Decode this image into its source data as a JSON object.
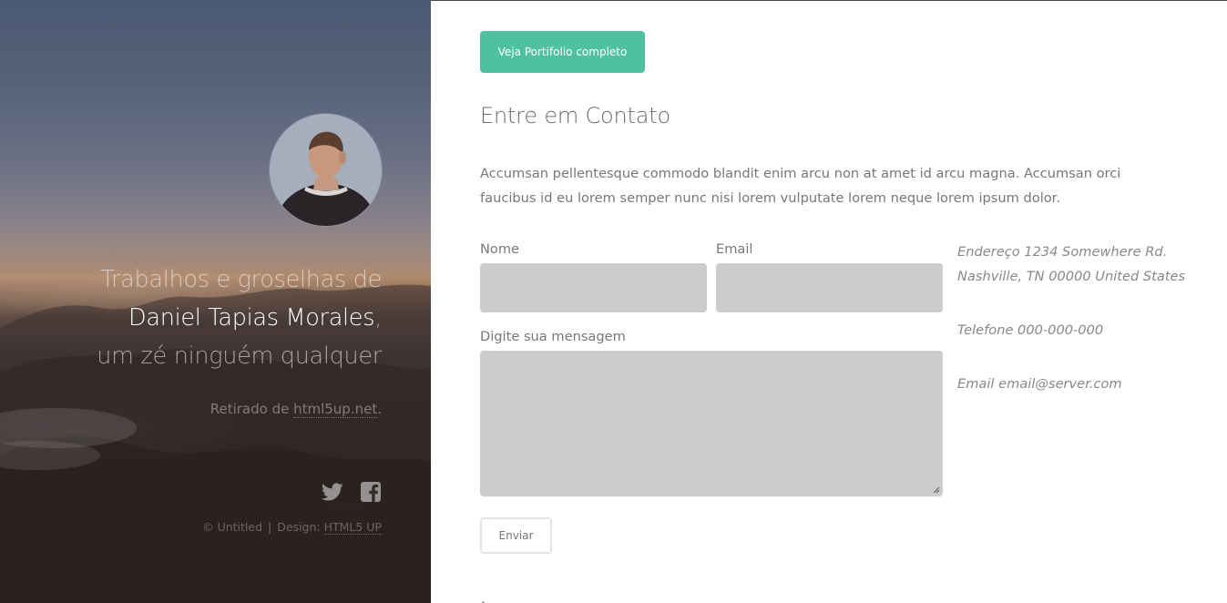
{
  "sidebar": {
    "intro_line1": "Trabalhos e groselhas de",
    "intro_name": "Daniel Tapias Morales",
    "intro_comma": ",",
    "intro_line3": "um zé ninguém qualquer",
    "credit_prefix": "Retirado de ",
    "credit_link": "html5up.net",
    "credit_suffix": ".",
    "social": [
      {
        "icon": "twitter-icon"
      },
      {
        "icon": "facebook-icon"
      }
    ],
    "footer_copy": "© Untitled",
    "footer_sep": "|",
    "footer_design_prefix": "Design: ",
    "footer_design_link": "HTML5 UP"
  },
  "main": {
    "portfolio_button": "Veja Portifolio completo",
    "contact_title": "Entre em Contato",
    "contact_description": "Accumsan pellentesque commodo blandit enim arcu non at amet id arcu magna. Accumsan orci faucibus id eu lorem semper nunc nisi lorem vulputate lorem neque lorem ipsum dolor.",
    "form": {
      "name_label": "Nome",
      "name_value": "",
      "email_label": "Email",
      "email_value": "",
      "message_label": "Digite sua mensagem",
      "message_value": "",
      "send_button": "Enviar"
    },
    "contact_info": {
      "address_line1": "Endereço 1234 Somewhere Rd.",
      "address_line2": "Nashville, TN 00000 United States",
      "phone": "Telefone 000-000-000",
      "email": "Email email@server.com"
    }
  },
  "colors": {
    "accent": "#4fc1a0",
    "field_bg": "#cccccc",
    "text": "#777777"
  }
}
